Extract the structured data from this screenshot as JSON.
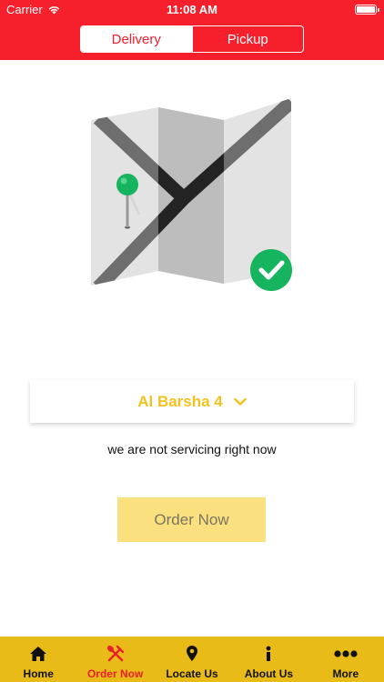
{
  "status_bar": {
    "carrier": "Carrier",
    "time": "11:08 AM"
  },
  "tabs": [
    {
      "label": "Delivery",
      "active": true
    },
    {
      "label": "Pickup",
      "active": false
    }
  ],
  "location": {
    "name": "Al Barsha 4",
    "icon": "chevron-down-icon"
  },
  "service_status": "we are not servicing right now",
  "order_button": {
    "label": "Order Now",
    "enabled": false
  },
  "bottom_nav": [
    {
      "label": "Home",
      "icon": "home-icon",
      "active": false
    },
    {
      "label": "Order Now",
      "icon": "cutlery-icon",
      "active": true
    },
    {
      "label": "Locate Us",
      "icon": "location-pin-icon",
      "active": false
    },
    {
      "label": "About Us",
      "icon": "info-icon",
      "active": false
    },
    {
      "label": "More",
      "icon": "more-icon",
      "active": false
    }
  ],
  "colors": {
    "brand_red": "#f5202c",
    "accent_yellow": "#e8bb19",
    "location_text": "#f2c31f",
    "button_disabled": "#fbe07f",
    "check_green": "#16b45e"
  }
}
